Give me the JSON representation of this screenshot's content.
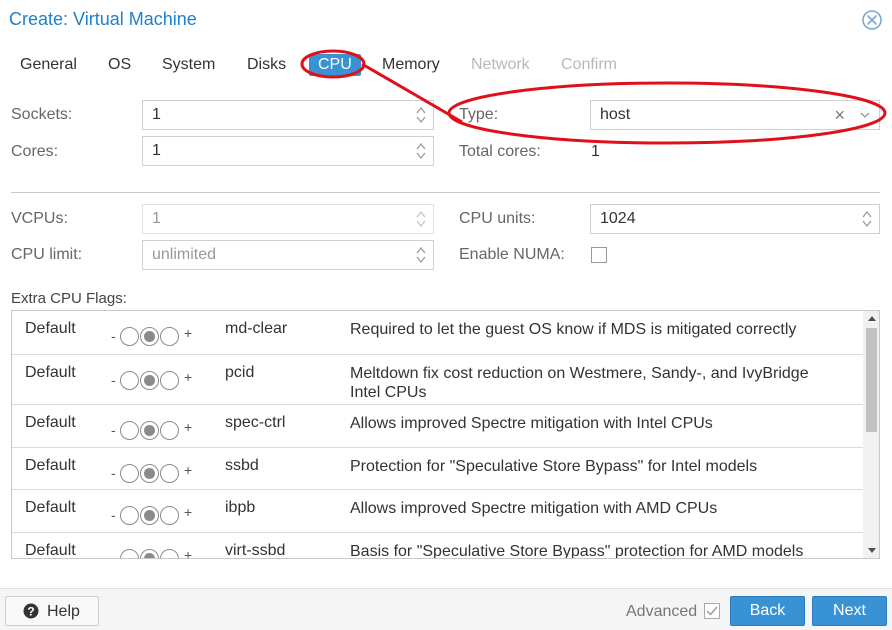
{
  "window": {
    "title": "Create: Virtual Machine",
    "close_icon": "close-circle-icon"
  },
  "tabs": [
    {
      "label": "General",
      "state": "normal"
    },
    {
      "label": "OS",
      "state": "normal"
    },
    {
      "label": "System",
      "state": "normal"
    },
    {
      "label": "Disks",
      "state": "normal"
    },
    {
      "label": "CPU",
      "state": "active"
    },
    {
      "label": "Memory",
      "state": "normal"
    },
    {
      "label": "Network",
      "state": "disabled"
    },
    {
      "label": "Confirm",
      "state": "disabled"
    }
  ],
  "form": {
    "sockets": {
      "label": "Sockets:",
      "value": "1"
    },
    "cores": {
      "label": "Cores:",
      "value": "1"
    },
    "type": {
      "label": "Type:",
      "value": "host"
    },
    "total_cores": {
      "label": "Total cores:",
      "value": "1"
    },
    "vcpus": {
      "label": "VCPUs:",
      "value": "1"
    },
    "cpu_limit": {
      "label": "CPU limit:",
      "placeholder": "unlimited"
    },
    "cpu_units": {
      "label": "CPU units:",
      "value": "1024"
    },
    "numa": {
      "label": "Enable NUMA:",
      "checked": false
    }
  },
  "flags": {
    "label": "Extra CPU Flags:",
    "rows": [
      {
        "state": "Default",
        "minus": "-",
        "plus": "+",
        "name": "md-clear",
        "description": "Required to let the guest OS know if MDS is mitigated correctly"
      },
      {
        "state": "Default",
        "minus": "-",
        "plus": "+",
        "name": "pcid",
        "description": "Meltdown fix cost reduction on Westmere, Sandy-, and IvyBridge Intel CPUs"
      },
      {
        "state": "Default",
        "minus": "-",
        "plus": "+",
        "name": "spec-ctrl",
        "description": "Allows improved Spectre mitigation with Intel CPUs"
      },
      {
        "state": "Default",
        "minus": "-",
        "plus": "+",
        "name": "ssbd",
        "description": "Protection for \"Speculative Store Bypass\" for Intel models"
      },
      {
        "state": "Default",
        "minus": "-",
        "plus": "+",
        "name": "ibpb",
        "description": "Allows improved Spectre mitigation with AMD CPUs"
      },
      {
        "state": "Default",
        "minus": "-",
        "plus": "+",
        "name": "virt-ssbd",
        "description": "Basis for \"Speculative Store Bypass\" protection for AMD models"
      }
    ]
  },
  "footer": {
    "help_label": "Help",
    "advanced_label": "Advanced",
    "advanced_checked": true,
    "back_label": "Back",
    "next_label": "Next"
  },
  "colors": {
    "title": "#1f7fc8",
    "accent": "#3892d4",
    "annotation": "#e0101a"
  }
}
